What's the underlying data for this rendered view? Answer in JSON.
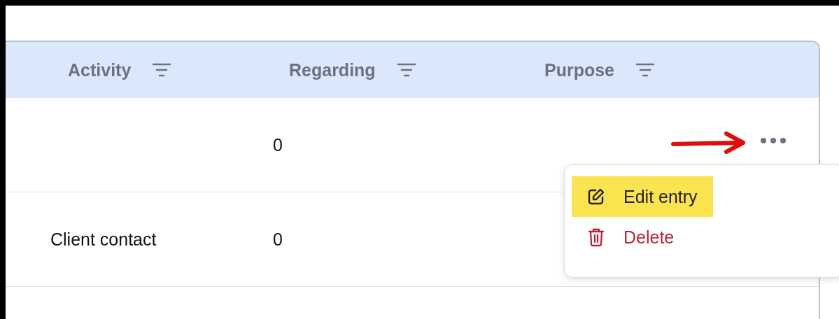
{
  "table": {
    "columns": [
      {
        "label": "Activity"
      },
      {
        "label": "Regarding"
      },
      {
        "label": "Purpose"
      }
    ],
    "rows": [
      {
        "regarding": "0"
      },
      {
        "activity": "Client contact",
        "regarding": "0"
      }
    ]
  },
  "row_menu": {
    "items": [
      {
        "kind": "edit",
        "label": "Edit entry",
        "highlighted": true
      },
      {
        "kind": "delete",
        "label": "Delete",
        "highlighted": false
      }
    ]
  }
}
